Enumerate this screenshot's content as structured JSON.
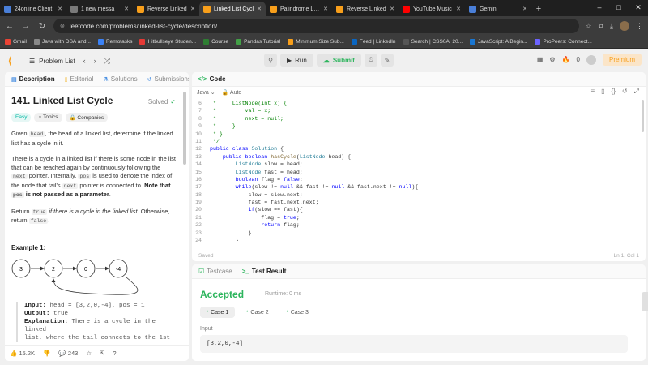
{
  "browser": {
    "tabs": [
      {
        "label": "24online Client",
        "color": "#4a7fd8"
      },
      {
        "label": "1 new messa",
        "color": "#7a7a7a"
      },
      {
        "label": "Reverse Linked",
        "color": "#f89f1b"
      },
      {
        "label": "Linked List Cycl",
        "color": "#f89f1b",
        "active": true
      },
      {
        "label": "Palindrome Link",
        "color": "#f89f1b"
      },
      {
        "label": "Reverse Linked",
        "color": "#f89f1b"
      },
      {
        "label": "YouTube Music",
        "color": "#ff0000"
      },
      {
        "label": "Gemini",
        "color": "#4a7fd8"
      }
    ],
    "url": "leetcode.com/problems/linked-list-cycle/description/",
    "bookmarks": [
      {
        "label": "Gmail",
        "color": "#ea4335"
      },
      {
        "label": "Java with DSA and...",
        "color": "#888"
      },
      {
        "label": "Remotasks",
        "color": "#3b82f6"
      },
      {
        "label": "Hitbullseye Studen...",
        "color": "#e53935"
      },
      {
        "label": "Course",
        "color": "#2e7d32"
      },
      {
        "label": "Pandas Tutorial",
        "color": "#43a047"
      },
      {
        "label": "Minimum Size Sub...",
        "color": "#f89f1b"
      },
      {
        "label": "Feed | LinkedIn",
        "color": "#0a66c2"
      },
      {
        "label": "Search | CSS0AI 20...",
        "color": "#555"
      },
      {
        "label": "JavaScript: A Begin...",
        "color": "#1976d2"
      },
      {
        "label": "ProPeers: Connect...",
        "color": "#6c63ff"
      }
    ]
  },
  "header": {
    "problem_list": "Problem List",
    "run": "Run",
    "submit": "Submit",
    "streak": "0",
    "premium": "Premium"
  },
  "left": {
    "tabs": [
      "Description",
      "Editorial",
      "Solutions",
      "Submissions"
    ],
    "title": "141. Linked List Cycle",
    "solved": "Solved",
    "difficulty": "Easy",
    "chips": [
      "Topics",
      "Companies"
    ],
    "example_title": "Example 1:",
    "nodes": [
      "3",
      "2",
      "0",
      "-4"
    ],
    "example": {
      "input_label": "Input:",
      "input": " head = [3,2,0,-4], pos = 1",
      "output_label": "Output:",
      "output": " true",
      "expl_label": "Explanation:",
      "expl": " There is a cycle in the linked",
      "expl2": "list, where the tail connects to the 1st"
    },
    "likes": "15.2K",
    "comments": "243"
  },
  "code": {
    "tab": "Code",
    "language": "Java",
    "mode": "Auto",
    "saved": "Saved",
    "position": "Ln 1, Col 1",
    "lines": [
      {
        "n": "6",
        "html": "<span class='cm'> *     ListNode(int x) {</span>"
      },
      {
        "n": "7",
        "html": "<span class='cm'> *         val = x;</span>"
      },
      {
        "n": "8",
        "html": "<span class='cm'> *         next = null;</span>"
      },
      {
        "n": "9",
        "html": "<span class='cm'> *     }</span>"
      },
      {
        "n": "10",
        "html": "<span class='cm'> * }</span>"
      },
      {
        "n": "11",
        "html": "<span class='cm'> */</span>"
      },
      {
        "n": "12",
        "html": "<span class='kw'>public class</span> <span class='ty'>Solution</span> {"
      },
      {
        "n": "13",
        "html": "    <span class='kw'>public boolean</span> <span class='fn'>hasCycle</span>(<span class='ty'>ListNode</span> head) {"
      },
      {
        "n": "14",
        "html": "        <span class='ty'>ListNode</span> slow = head;"
      },
      {
        "n": "15",
        "html": "        <span class='ty'>ListNode</span> fast = head;"
      },
      {
        "n": "16",
        "html": "        <span class='kw'>boolean</span> flag = <span class='kw'>false</span>;"
      },
      {
        "n": "17",
        "html": "        <span class='kw'>while</span>(slow != <span class='kw'>null</span> &amp;&amp; fast != <span class='kw'>null</span> &amp;&amp; fast.next != <span class='kw'>null</span>){"
      },
      {
        "n": "18",
        "html": "            slow = slow.next;"
      },
      {
        "n": "19",
        "html": "            fast = fast.next.next;"
      },
      {
        "n": "20",
        "html": "            <span class='kw'>if</span>(slow == fast){"
      },
      {
        "n": "21",
        "html": "                flag = <span class='kw'>true</span>;"
      },
      {
        "n": "22",
        "html": "                <span class='kw'>return</span> flag;"
      },
      {
        "n": "23",
        "html": "            }"
      },
      {
        "n": "24",
        "html": "        }"
      }
    ]
  },
  "test": {
    "tabs": [
      "Testcase",
      "Test Result"
    ],
    "status": "Accepted",
    "runtime": "Runtime: 0 ms",
    "cases": [
      "Case 1",
      "Case 2",
      "Case 3"
    ],
    "input_label": "Input",
    "input_value": "[3,2,0,-4]"
  }
}
